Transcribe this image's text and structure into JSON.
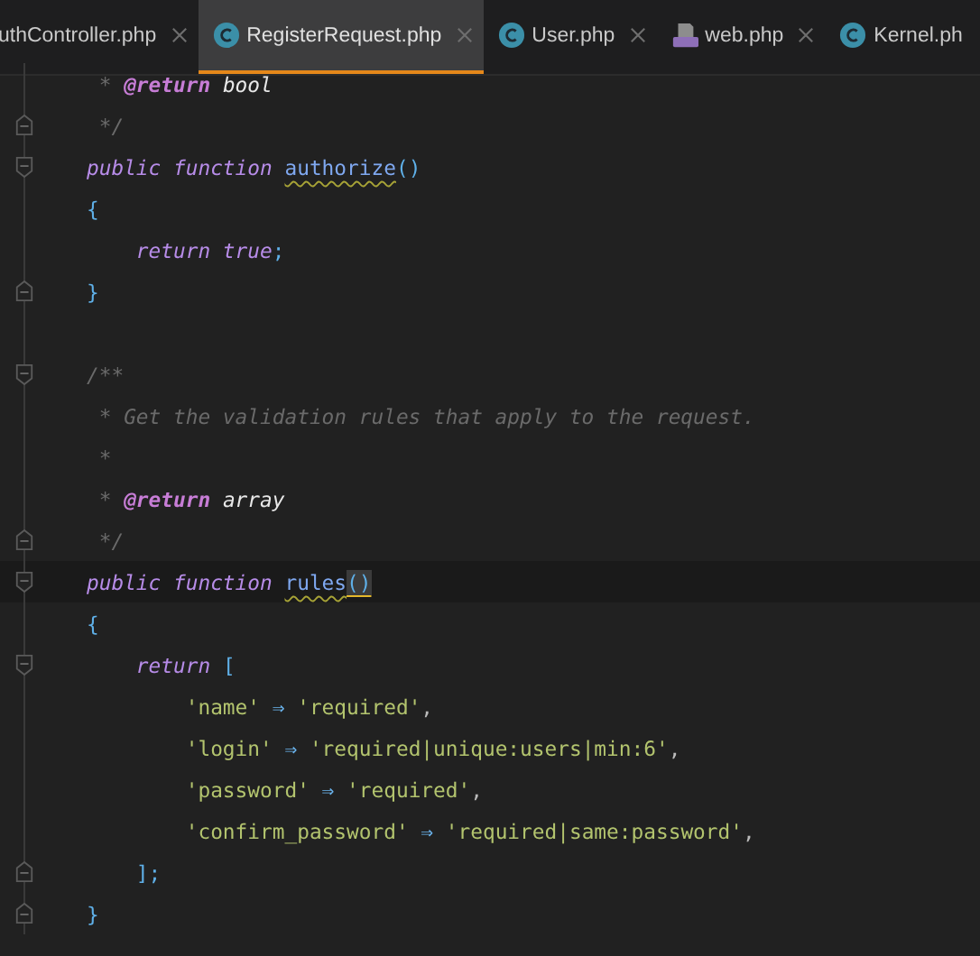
{
  "tabs": [
    {
      "label": "uthController.php",
      "kind": "plain",
      "selected": false
    },
    {
      "label": "RegisterRequest.php",
      "kind": "class",
      "selected": true
    },
    {
      "label": "User.php",
      "kind": "class",
      "selected": false
    },
    {
      "label": "web.php",
      "kind": "php",
      "selected": false
    },
    {
      "label": "Kernel.ph",
      "kind": "class",
      "selected": false
    }
  ],
  "lines": [
    {
      "kind": "code",
      "tokens": [
        {
          "text": " * ",
          "kind": "comment"
        },
        {
          "text": "@return",
          "kind": "doctag"
        },
        {
          "text": " bool",
          "kind": "doctype"
        }
      ]
    },
    {
      "kind": "fold-end",
      "tokens": [
        {
          "text": " */",
          "kind": "comment"
        }
      ]
    },
    {
      "kind": "fold-start",
      "tokens": [
        {
          "text": "public function ",
          "kind": "keyword"
        },
        {
          "text": "authorize",
          "kind": "fn",
          "warning": true
        },
        {
          "text": "()",
          "kind": "brace"
        }
      ]
    },
    {
      "kind": "code",
      "tokens": [
        {
          "text": "{",
          "kind": "brace"
        }
      ]
    },
    {
      "kind": "code",
      "tokens": [
        {
          "text": "    return true",
          "kind": "keyword"
        },
        {
          "text": ";",
          "kind": "brace"
        }
      ]
    },
    {
      "kind": "fold-end",
      "tokens": [
        {
          "text": "}",
          "kind": "brace"
        }
      ]
    },
    {
      "kind": "blank"
    },
    {
      "kind": "fold-start",
      "tokens": [
        {
          "text": "/**",
          "kind": "comment"
        }
      ]
    },
    {
      "kind": "code",
      "tokens": [
        {
          "text": " * Get the validation rules that apply to the request.",
          "kind": "comment"
        }
      ]
    },
    {
      "kind": "code",
      "tokens": [
        {
          "text": " *",
          "kind": "comment"
        }
      ]
    },
    {
      "kind": "code",
      "tokens": [
        {
          "text": " * ",
          "kind": "comment"
        },
        {
          "text": "@return",
          "kind": "doctag"
        },
        {
          "text": " array",
          "kind": "doctype"
        }
      ]
    },
    {
      "kind": "fold-end",
      "tokens": [
        {
          "text": " */",
          "kind": "comment"
        }
      ]
    },
    {
      "kind": "fold-start",
      "current": true,
      "tokens": [
        {
          "text": "public function ",
          "kind": "keyword"
        },
        {
          "text": "rules",
          "kind": "fn",
          "warning": true
        },
        {
          "text": "()",
          "kind": "brace",
          "matched": true
        }
      ]
    },
    {
      "kind": "code",
      "tokens": [
        {
          "text": "{",
          "kind": "brace"
        }
      ]
    },
    {
      "kind": "fold-start",
      "tokens": [
        {
          "text": "    return ",
          "kind": "keyword"
        },
        {
          "text": "[",
          "kind": "brace"
        }
      ]
    },
    {
      "kind": "code",
      "tokens": [
        {
          "text": "        'name'",
          "kind": "string"
        },
        {
          "text": " ⇒ ",
          "kind": "op"
        },
        {
          "text": "'required'",
          "kind": "string"
        },
        {
          "text": ",",
          "kind": "plain"
        }
      ]
    },
    {
      "kind": "code",
      "tokens": [
        {
          "text": "        'login'",
          "kind": "string"
        },
        {
          "text": " ⇒ ",
          "kind": "op"
        },
        {
          "text": "'required|unique:users|min:6'",
          "kind": "string"
        },
        {
          "text": ",",
          "kind": "plain"
        }
      ]
    },
    {
      "kind": "code",
      "tokens": [
        {
          "text": "        'password'",
          "kind": "string"
        },
        {
          "text": " ⇒ ",
          "kind": "op"
        },
        {
          "text": "'required'",
          "kind": "string"
        },
        {
          "text": ",",
          "kind": "plain"
        }
      ]
    },
    {
      "kind": "code",
      "tokens": [
        {
          "text": "        'confirm_password'",
          "kind": "string"
        },
        {
          "text": " ⇒ ",
          "kind": "op"
        },
        {
          "text": "'required|same:password'",
          "kind": "string"
        },
        {
          "text": ",",
          "kind": "plain"
        }
      ]
    },
    {
      "kind": "fold-end",
      "tokens": [
        {
          "text": "    ];",
          "kind": "brace"
        }
      ]
    },
    {
      "kind": "fold-end",
      "tokens": [
        {
          "text": "}",
          "kind": "brace"
        }
      ]
    }
  ]
}
